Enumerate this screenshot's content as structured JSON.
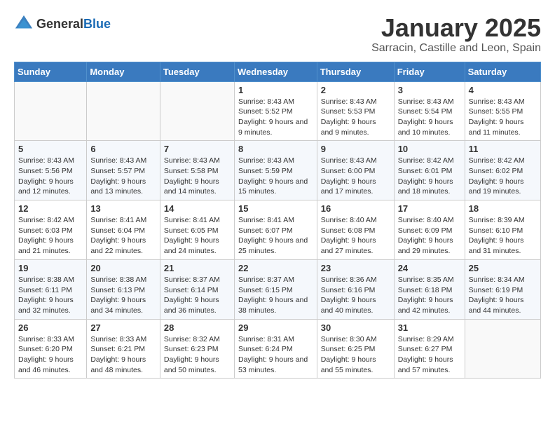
{
  "header": {
    "logo_general": "General",
    "logo_blue": "Blue",
    "main_title": "January 2025",
    "sub_title": "Sarracin, Castille and Leon, Spain"
  },
  "weekdays": [
    "Sunday",
    "Monday",
    "Tuesday",
    "Wednesday",
    "Thursday",
    "Friday",
    "Saturday"
  ],
  "weeks": [
    [
      {
        "day": "",
        "sunrise": "",
        "sunset": "",
        "daylight": ""
      },
      {
        "day": "",
        "sunrise": "",
        "sunset": "",
        "daylight": ""
      },
      {
        "day": "",
        "sunrise": "",
        "sunset": "",
        "daylight": ""
      },
      {
        "day": "1",
        "sunrise": "Sunrise: 8:43 AM",
        "sunset": "Sunset: 5:52 PM",
        "daylight": "Daylight: 9 hours and 9 minutes."
      },
      {
        "day": "2",
        "sunrise": "Sunrise: 8:43 AM",
        "sunset": "Sunset: 5:53 PM",
        "daylight": "Daylight: 9 hours and 9 minutes."
      },
      {
        "day": "3",
        "sunrise": "Sunrise: 8:43 AM",
        "sunset": "Sunset: 5:54 PM",
        "daylight": "Daylight: 9 hours and 10 minutes."
      },
      {
        "day": "4",
        "sunrise": "Sunrise: 8:43 AM",
        "sunset": "Sunset: 5:55 PM",
        "daylight": "Daylight: 9 hours and 11 minutes."
      }
    ],
    [
      {
        "day": "5",
        "sunrise": "Sunrise: 8:43 AM",
        "sunset": "Sunset: 5:56 PM",
        "daylight": "Daylight: 9 hours and 12 minutes."
      },
      {
        "day": "6",
        "sunrise": "Sunrise: 8:43 AM",
        "sunset": "Sunset: 5:57 PM",
        "daylight": "Daylight: 9 hours and 13 minutes."
      },
      {
        "day": "7",
        "sunrise": "Sunrise: 8:43 AM",
        "sunset": "Sunset: 5:58 PM",
        "daylight": "Daylight: 9 hours and 14 minutes."
      },
      {
        "day": "8",
        "sunrise": "Sunrise: 8:43 AM",
        "sunset": "Sunset: 5:59 PM",
        "daylight": "Daylight: 9 hours and 15 minutes."
      },
      {
        "day": "9",
        "sunrise": "Sunrise: 8:43 AM",
        "sunset": "Sunset: 6:00 PM",
        "daylight": "Daylight: 9 hours and 17 minutes."
      },
      {
        "day": "10",
        "sunrise": "Sunrise: 8:42 AM",
        "sunset": "Sunset: 6:01 PM",
        "daylight": "Daylight: 9 hours and 18 minutes."
      },
      {
        "day": "11",
        "sunrise": "Sunrise: 8:42 AM",
        "sunset": "Sunset: 6:02 PM",
        "daylight": "Daylight: 9 hours and 19 minutes."
      }
    ],
    [
      {
        "day": "12",
        "sunrise": "Sunrise: 8:42 AM",
        "sunset": "Sunset: 6:03 PM",
        "daylight": "Daylight: 9 hours and 21 minutes."
      },
      {
        "day": "13",
        "sunrise": "Sunrise: 8:41 AM",
        "sunset": "Sunset: 6:04 PM",
        "daylight": "Daylight: 9 hours and 22 minutes."
      },
      {
        "day": "14",
        "sunrise": "Sunrise: 8:41 AM",
        "sunset": "Sunset: 6:05 PM",
        "daylight": "Daylight: 9 hours and 24 minutes."
      },
      {
        "day": "15",
        "sunrise": "Sunrise: 8:41 AM",
        "sunset": "Sunset: 6:07 PM",
        "daylight": "Daylight: 9 hours and 25 minutes."
      },
      {
        "day": "16",
        "sunrise": "Sunrise: 8:40 AM",
        "sunset": "Sunset: 6:08 PM",
        "daylight": "Daylight: 9 hours and 27 minutes."
      },
      {
        "day": "17",
        "sunrise": "Sunrise: 8:40 AM",
        "sunset": "Sunset: 6:09 PM",
        "daylight": "Daylight: 9 hours and 29 minutes."
      },
      {
        "day": "18",
        "sunrise": "Sunrise: 8:39 AM",
        "sunset": "Sunset: 6:10 PM",
        "daylight": "Daylight: 9 hours and 31 minutes."
      }
    ],
    [
      {
        "day": "19",
        "sunrise": "Sunrise: 8:38 AM",
        "sunset": "Sunset: 6:11 PM",
        "daylight": "Daylight: 9 hours and 32 minutes."
      },
      {
        "day": "20",
        "sunrise": "Sunrise: 8:38 AM",
        "sunset": "Sunset: 6:13 PM",
        "daylight": "Daylight: 9 hours and 34 minutes."
      },
      {
        "day": "21",
        "sunrise": "Sunrise: 8:37 AM",
        "sunset": "Sunset: 6:14 PM",
        "daylight": "Daylight: 9 hours and 36 minutes."
      },
      {
        "day": "22",
        "sunrise": "Sunrise: 8:37 AM",
        "sunset": "Sunset: 6:15 PM",
        "daylight": "Daylight: 9 hours and 38 minutes."
      },
      {
        "day": "23",
        "sunrise": "Sunrise: 8:36 AM",
        "sunset": "Sunset: 6:16 PM",
        "daylight": "Daylight: 9 hours and 40 minutes."
      },
      {
        "day": "24",
        "sunrise": "Sunrise: 8:35 AM",
        "sunset": "Sunset: 6:18 PM",
        "daylight": "Daylight: 9 hours and 42 minutes."
      },
      {
        "day": "25",
        "sunrise": "Sunrise: 8:34 AM",
        "sunset": "Sunset: 6:19 PM",
        "daylight": "Daylight: 9 hours and 44 minutes."
      }
    ],
    [
      {
        "day": "26",
        "sunrise": "Sunrise: 8:33 AM",
        "sunset": "Sunset: 6:20 PM",
        "daylight": "Daylight: 9 hours and 46 minutes."
      },
      {
        "day": "27",
        "sunrise": "Sunrise: 8:33 AM",
        "sunset": "Sunset: 6:21 PM",
        "daylight": "Daylight: 9 hours and 48 minutes."
      },
      {
        "day": "28",
        "sunrise": "Sunrise: 8:32 AM",
        "sunset": "Sunset: 6:23 PM",
        "daylight": "Daylight: 9 hours and 50 minutes."
      },
      {
        "day": "29",
        "sunrise": "Sunrise: 8:31 AM",
        "sunset": "Sunset: 6:24 PM",
        "daylight": "Daylight: 9 hours and 53 minutes."
      },
      {
        "day": "30",
        "sunrise": "Sunrise: 8:30 AM",
        "sunset": "Sunset: 6:25 PM",
        "daylight": "Daylight: 9 hours and 55 minutes."
      },
      {
        "day": "31",
        "sunrise": "Sunrise: 8:29 AM",
        "sunset": "Sunset: 6:27 PM",
        "daylight": "Daylight: 9 hours and 57 minutes."
      },
      {
        "day": "",
        "sunrise": "",
        "sunset": "",
        "daylight": ""
      }
    ]
  ]
}
